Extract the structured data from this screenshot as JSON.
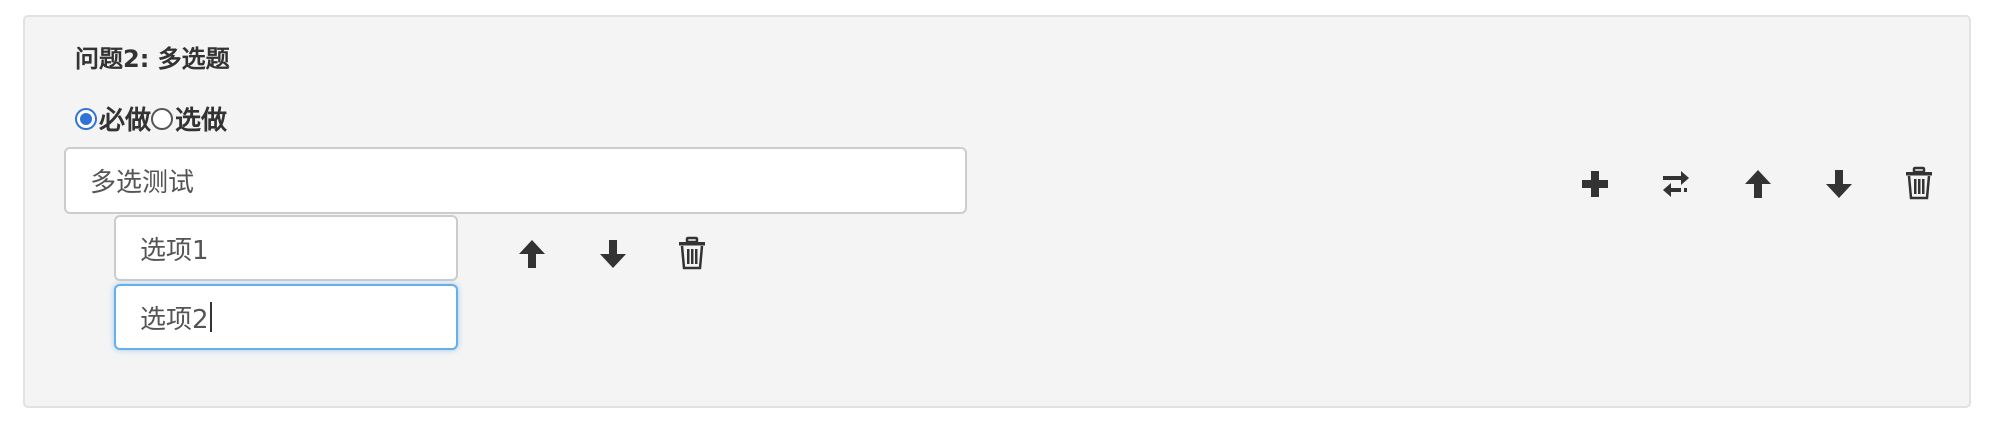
{
  "question": {
    "title": "问题2: 多选题",
    "required_options": [
      {
        "label": "必做",
        "checked": true
      },
      {
        "label": "选做",
        "checked": false
      }
    ],
    "text_value": "多选测试",
    "actions": [
      "plus-icon",
      "swap-icon",
      "arrow-up-icon",
      "arrow-down-icon",
      "trash-icon"
    ]
  },
  "options": [
    {
      "value": "选项1",
      "focused": false,
      "actions": [
        "arrow-up-icon",
        "arrow-down-icon",
        "trash-icon"
      ]
    },
    {
      "value": "选项2",
      "focused": true
    }
  ],
  "colors": {
    "panel_bg": "#f4f4f4",
    "panel_border": "#e2e2e2",
    "radio_accent": "#2f73d9",
    "focus_border": "#66afe9",
    "icon": "#333333"
  }
}
